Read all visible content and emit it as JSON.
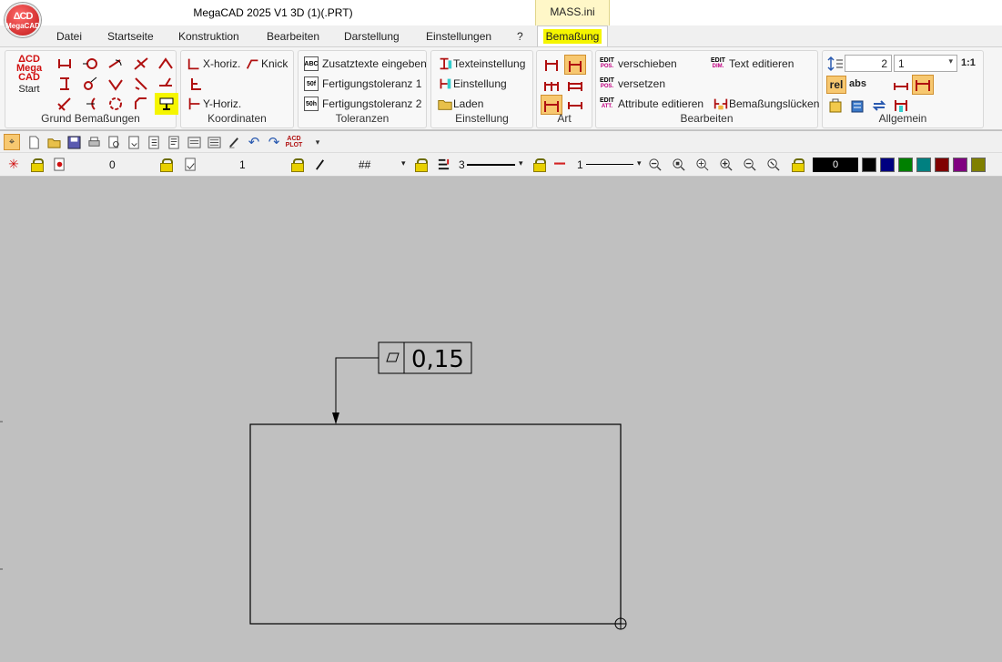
{
  "window": {
    "title": "MegaCAD 2025 V1 3D (1)(.PRT)",
    "context_tab_header": "MASS.ini",
    "logo_text": "MegaCAD"
  },
  "tabs": [
    "Datei",
    "Startseite",
    "Konstruktion",
    "Bearbeiten",
    "Darstellung",
    "Einstellungen",
    "?",
    "Bemaßung"
  ],
  "ribbon": {
    "start": {
      "logo": "MegaCAD",
      "label": "Start"
    },
    "groups": {
      "grund": "Grund Bemaßungen",
      "koordinaten": "Koordinaten",
      "toleranzen": "Toleranzen",
      "einstellung": "Einstellung",
      "art": "Art",
      "bearbeiten": "Bearbeiten",
      "allgemein": "Allgemein"
    },
    "koordinaten_items": {
      "x_horiz": "X-horiz.",
      "knick": "Knick",
      "y_horiz": "Y-Horiz."
    },
    "toleranzen_items": {
      "zusatz": "Zusatztexte eingeben",
      "fert1": "Fertigungstoleranz 1",
      "fert2": "Fertigungstoleranz 2"
    },
    "einstellung_items": {
      "texteinstellung": "Texteinstellung",
      "einstellung": "Einstellung",
      "laden": "Laden"
    },
    "bearbeiten_items": {
      "verschieben": "verschieben",
      "text_editieren": "Text editieren",
      "versetzen": "versetzen",
      "attribute": "Attribute editieren",
      "luecken": "Bemaßungslücken"
    },
    "allgemein_items": {
      "field1": "2",
      "field2": "1",
      "scale": "1:1",
      "rel": "rel",
      "abs": "abs"
    }
  },
  "toolbar2": {
    "value_a": "0",
    "value_b": "1",
    "pattern": "##",
    "line_width": "3",
    "line_type": "1",
    "color_value": "0"
  },
  "colors": {
    "accent_highlight": "#f5f500",
    "swatches": [
      "#000000",
      "#000080",
      "#008000",
      "#008080",
      "#800000",
      "#800080",
      "#808000"
    ]
  },
  "drawing": {
    "feature_control_frame": {
      "symbol": "flatness-parallelogram",
      "value": "0,15"
    }
  }
}
